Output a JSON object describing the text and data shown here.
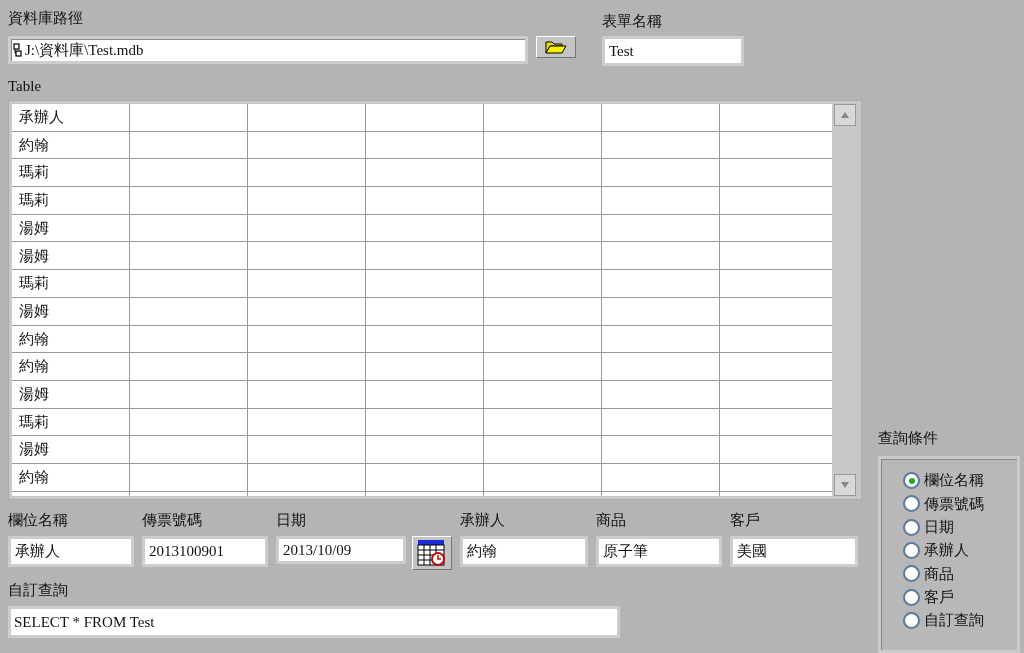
{
  "db_path": {
    "label": "資料庫路徑",
    "value": "J:\\資料庫\\Test.mdb"
  },
  "form_name": {
    "label": "表單名稱",
    "value": "Test"
  },
  "table": {
    "label": "Table",
    "rows": [
      {
        "cells": [
          "承辦人"
        ]
      },
      {
        "cells": [
          "約翰"
        ]
      },
      {
        "cells": [
          "瑪莉"
        ]
      },
      {
        "cells": [
          "瑪莉"
        ]
      },
      {
        "cells": [
          "湯姆"
        ]
      },
      {
        "cells": [
          "湯姆"
        ]
      },
      {
        "cells": [
          "瑪莉"
        ]
      },
      {
        "cells": [
          "湯姆"
        ]
      },
      {
        "cells": [
          "約翰"
        ]
      },
      {
        "cells": [
          "約翰"
        ]
      },
      {
        "cells": [
          "湯姆"
        ]
      },
      {
        "cells": [
          "瑪莉"
        ]
      },
      {
        "cells": [
          "湯姆"
        ]
      },
      {
        "cells": [
          "約翰"
        ]
      }
    ]
  },
  "fields": [
    {
      "kind": "text",
      "label": "欄位名稱",
      "value": "承辦人"
    },
    {
      "kind": "text",
      "label": "傳票號碼",
      "value": "2013100901"
    },
    {
      "kind": "date",
      "label": "日期",
      "value": "2013/10/09"
    },
    {
      "kind": "text",
      "label": "承辦人",
      "value": "約翰"
    },
    {
      "kind": "text",
      "label": "商品",
      "value": "原子筆"
    },
    {
      "kind": "text",
      "label": "客戶",
      "value": "美國"
    }
  ],
  "custom_query": {
    "label": "自訂查詢",
    "value": "SELECT * FROM Test"
  },
  "query_conditions": {
    "label": "查詢條件",
    "options": [
      {
        "label": "欄位名稱",
        "selected": true
      },
      {
        "label": "傳票號碼",
        "selected": false
      },
      {
        "label": "日期",
        "selected": false
      },
      {
        "label": "承辦人",
        "selected": false
      },
      {
        "label": "商品",
        "selected": false
      },
      {
        "label": "客戶",
        "selected": false
      },
      {
        "label": "自訂查詢",
        "selected": false
      }
    ]
  }
}
